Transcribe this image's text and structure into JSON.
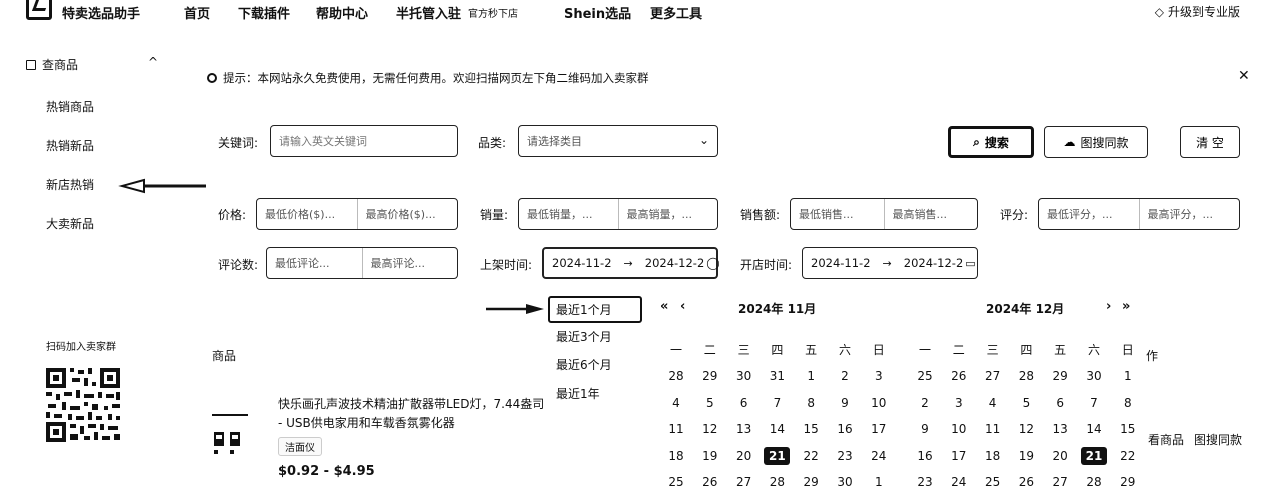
{
  "nav": {
    "brand": "特卖选品助手",
    "items": [
      "首页",
      "下载插件",
      "帮助中心",
      "半托管入驻"
    ],
    "shop_link": "官方秒下店",
    "shein": "Shein选品",
    "more": "更多工具",
    "upgrade": "升级到专业版"
  },
  "sidebar": {
    "section": "查商品",
    "items": [
      "热销商品",
      "热销新品",
      "新店热销",
      "大卖新品"
    ],
    "qr_label": "扫码加入卖家群"
  },
  "notice": {
    "text": "提示：本网站永久免费使用，无需任何费用。欢迎扫描网页左下角二维码加入卖家群"
  },
  "form": {
    "keyword_label": "关键词:",
    "keyword_placeholder": "请输入英文关键词",
    "category_label": "品类:",
    "category_placeholder": "请选择类目",
    "search_btn": "搜索",
    "image_search_btn": "图搜同款",
    "clear_btn": "清 空",
    "price_label": "价格:",
    "price_min": "最低价格($)...",
    "price_max": "最高价格($)...",
    "sales_label": "销量:",
    "sales_min": "最低销量，...",
    "sales_max": "最高销量，...",
    "revenue_label": "销售额:",
    "revenue_min": "最低销售...",
    "revenue_max": "最高销售...",
    "rating_label": "评分:",
    "rating_min": "最低评分，...",
    "rating_max": "最高评分，...",
    "reviews_label": "评论数:",
    "reviews_min": "最低评论...",
    "reviews_max": "最高评论...",
    "listed_label": "上架时间:",
    "listed_start": "2024-11-2",
    "listed_end": "2024-12-2",
    "shop_label": "开店时间:",
    "shop_start": "2024-11-2",
    "shop_end": "2024-12-2",
    "range_sep": "→"
  },
  "quick_ranges": [
    "最近1个月",
    "最近3个月",
    "最近6个月",
    "最近1年"
  ],
  "calendar": {
    "weekdays": [
      "一",
      "二",
      "三",
      "四",
      "五",
      "六",
      "日"
    ],
    "left_title": "2024年  11月",
    "right_title": "2024年  12月",
    "left_rows": [
      [
        "28",
        "29",
        "30",
        "31",
        "1",
        "2",
        "3"
      ],
      [
        "4",
        "5",
        "6",
        "7",
        "8",
        "9",
        "10"
      ],
      [
        "11",
        "12",
        "13",
        "14",
        "15",
        "16",
        "17"
      ],
      [
        "18",
        "19",
        "20",
        "21",
        "22",
        "23",
        "24"
      ],
      [
        "25",
        "26",
        "27",
        "28",
        "29",
        "30",
        "1"
      ]
    ],
    "right_rows": [
      [
        "25",
        "26",
        "27",
        "28",
        "29",
        "30",
        "1"
      ],
      [
        "2",
        "3",
        "4",
        "5",
        "6",
        "7",
        "8"
      ],
      [
        "9",
        "10",
        "11",
        "12",
        "13",
        "14",
        "15"
      ],
      [
        "16",
        "17",
        "18",
        "19",
        "20",
        "21",
        "22"
      ],
      [
        "23",
        "24",
        "25",
        "26",
        "27",
        "28",
        "29"
      ]
    ],
    "today": "21"
  },
  "table": {
    "product_header": "商品",
    "op_header": "作",
    "product_title_1": "快乐画孔声波技术精油扩散器带LED灯，7.44盎司",
    "product_title_2": "- USB供电家用和车载香氛雾化器",
    "product_tag": "洁面仪",
    "product_price": "$0.92 - $4.95",
    "op_view": "看商品",
    "op_image": "图搜同款"
  }
}
